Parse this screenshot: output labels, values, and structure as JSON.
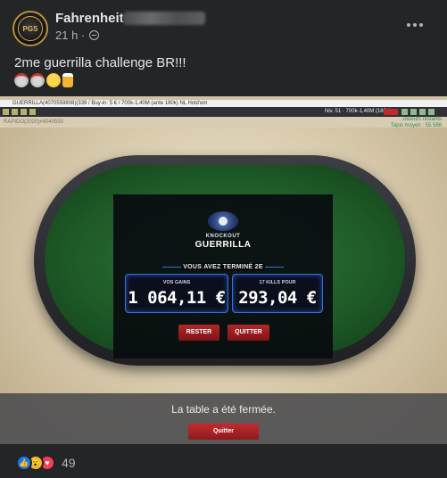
{
  "post": {
    "author": "Fahrenheit",
    "time": "21 h ·",
    "text": "2me guerrilla challenge BR!!!",
    "avatar_text": "PGS",
    "more_icon": "more-horiz-icon",
    "privacy_icon": "globe-icon"
  },
  "screenshot": {
    "titlebar": "GUERRILLA(4070559808)(339 / Buy-in: 5 € / 700k-1,40M (ante 180k) NL Hold'em",
    "level": "Niv. 51 · 700k-1,40M (180k)",
    "subbar_left": "RAPIDO(2020)#4040550",
    "subbar_right_1": "Joueurs restants",
    "subbar_right_2": "Tapis moyen : 55 588",
    "ko_title": "KNOCKOUT",
    "ko_subtitle": "GUERRILLA",
    "finish_text": "VOUS AVEZ TERMINÉ 2E",
    "gains_label": "VOS GAINS",
    "gains_value": "1 064,11 €",
    "kills_label": "17 KILLS POUR",
    "kills_value": "293,04 €",
    "btn_rester": "RESTER",
    "btn_quitter": "QUITTER",
    "closed_message": "La table a été fermée.",
    "btn_quit_bottom": "Quitter"
  },
  "reactions": {
    "count": "49",
    "types": [
      "like-icon",
      "wow-icon",
      "love-icon"
    ],
    "colors": {
      "like": "#1877f2",
      "wow": "#f7b928",
      "love": "#f33e58"
    }
  }
}
